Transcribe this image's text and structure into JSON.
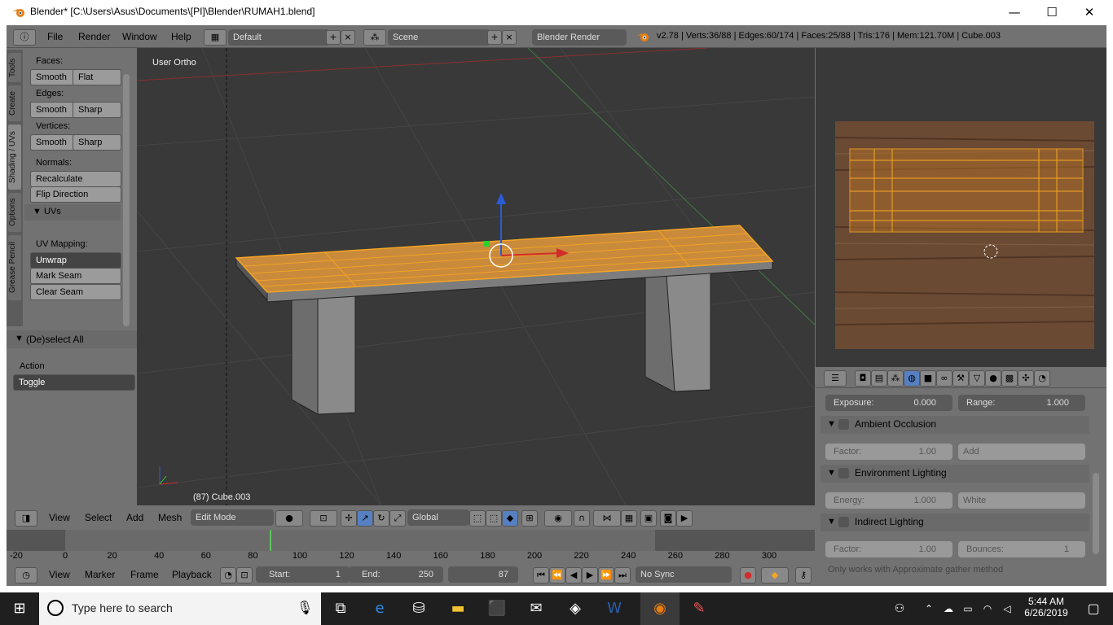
{
  "window": {
    "title": "Blender* [C:\\Users\\Asus\\Documents\\[PI]\\Blender\\RUMAH1.blend]",
    "min_label": "—",
    "max_label": "☐",
    "close_label": "✕"
  },
  "infobar": {
    "menus": [
      "File",
      "Render",
      "Window",
      "Help"
    ],
    "layout": "Default",
    "scene": "Scene",
    "engine": "Blender Render",
    "stats": "v2.78 | Verts:36/88 | Edges:60/174 | Faces:25/88 | Tris:176 | Mem:121.70M | Cube.003"
  },
  "tabs": [
    "Tools",
    "Create",
    "Shading / UVs",
    "Options",
    "Grease Pencil"
  ],
  "toolshelf": {
    "faces_label": "Faces:",
    "edges_label": "Edges:",
    "vertices_label": "Vertices:",
    "normals_label": "Normals:",
    "smooth": "Smooth",
    "flat": "Flat",
    "sharp": "Sharp",
    "recalculate": "Recalculate",
    "flip_direction": "Flip Direction",
    "uvs_panel": "UVs",
    "uv_mapping_label": "UV Mapping:",
    "unwrap": "Unwrap",
    "mark_seam": "Mark Seam",
    "clear_seam": "Clear Seam",
    "operator_panel": "(De)select All",
    "action_label": "Action",
    "action_value": "Toggle"
  },
  "viewport": {
    "view_label": "User Ortho",
    "object_label": "(87) Cube.003"
  },
  "vpheader": {
    "menus": [
      "View",
      "Select",
      "Add",
      "Mesh"
    ],
    "mode": "Edit Mode",
    "orientation": "Global"
  },
  "timeline": {
    "ticks": [
      "-20",
      "0",
      "20",
      "40",
      "60",
      "80",
      "100",
      "120",
      "140",
      "160",
      "180",
      "200",
      "220",
      "240",
      "260",
      "280",
      "300"
    ],
    "current_frame_value": 87
  },
  "tlheader": {
    "menus": [
      "View",
      "Marker",
      "Frame",
      "Playback"
    ],
    "start_label": "Start:",
    "start_value": "1",
    "end_label": "End:",
    "end_value": "250",
    "current": "87",
    "sync": "No Sync"
  },
  "props": {
    "exposure_label": "Exposure:",
    "exposure_value": "0.000",
    "range_label": "Range:",
    "range_value": "1.000",
    "ao_title": "Ambient Occlusion",
    "ao_factor_label": "Factor:",
    "ao_factor_value": "1.00",
    "ao_blend": "Add",
    "env_title": "Environment Lighting",
    "env_energy_label": "Energy:",
    "env_energy_value": "1.000",
    "env_color": "White",
    "ind_title": "Indirect Lighting",
    "ind_factor_label": "Factor:",
    "ind_factor_value": "1.00",
    "ind_bounces_label": "Bounces:",
    "ind_bounces_value": "1",
    "note": "Only works with Approximate gather method"
  },
  "taskbar": {
    "search_placeholder": "Type here to search",
    "time": "5:44 AM",
    "date": "6/26/2019"
  },
  "colors": {
    "selection_orange": "#f5a623",
    "viewport_bg": "#393939",
    "ui_grey": "#727272"
  }
}
